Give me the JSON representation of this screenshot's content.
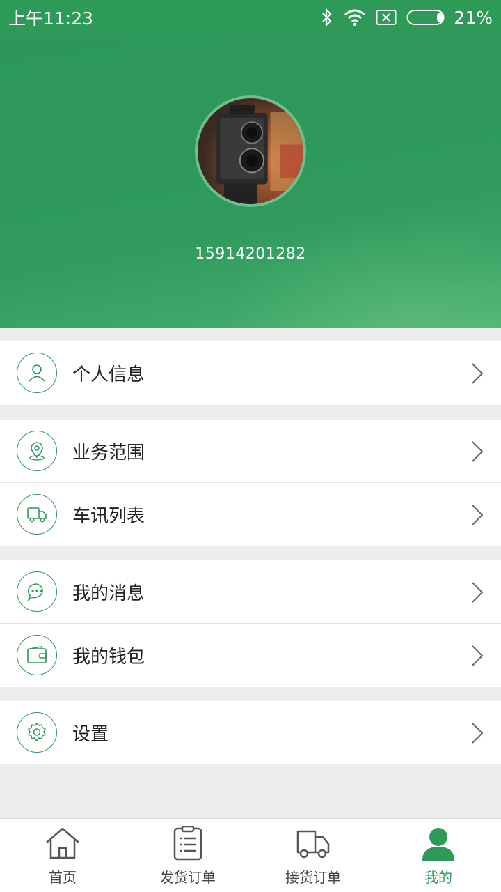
{
  "status_bar": {
    "time": "上午11:23",
    "battery": "21%",
    "icons": [
      "bluetooth-icon",
      "wifi-icon",
      "no-sim-icon",
      "battery-icon"
    ]
  },
  "profile": {
    "phone": "15914201282",
    "avatar": "camera-photo-avatar"
  },
  "menu": {
    "personal_info": "个人信息",
    "business_scope": "业务范围",
    "vehicle_list": "车讯列表",
    "my_messages": "我的消息",
    "my_wallet": "我的钱包",
    "settings": "设置"
  },
  "tabs": {
    "home": "首页",
    "ship_orders": "发货订单",
    "receive_orders": "接货订单",
    "mine": "我的"
  },
  "colors": {
    "accent": "#2e9a58",
    "header": "#2f9a5c",
    "background": "#ececec"
  }
}
